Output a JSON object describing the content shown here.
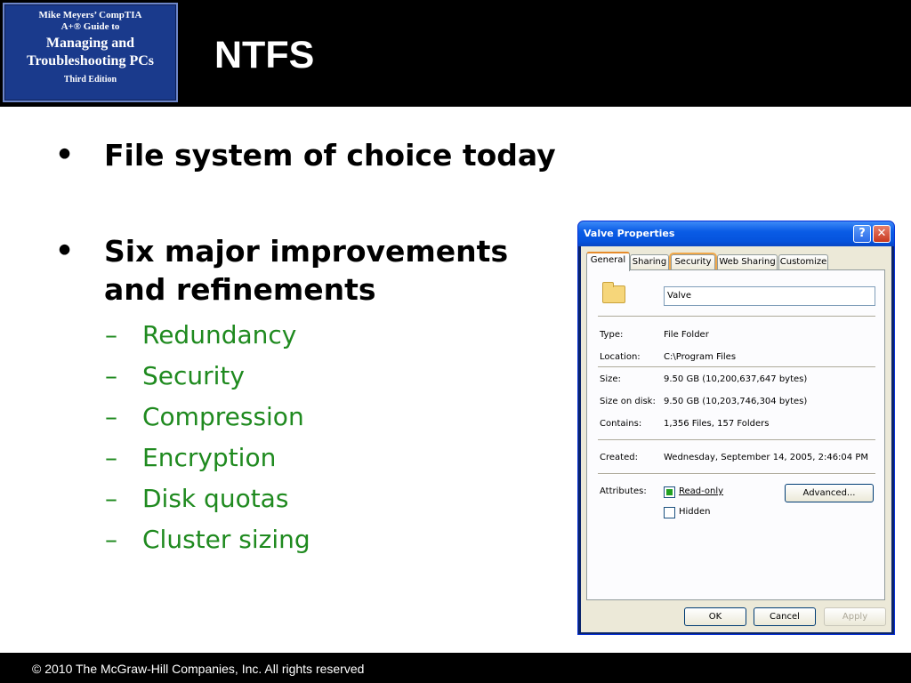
{
  "header": {
    "book": {
      "line1": "Mike Meyers’ CompTIA",
      "line2": "A+® Guide to",
      "line3": "Managing and",
      "line4": "Troubleshooting PCs",
      "line5": "Third Edition"
    },
    "title": "NTFS"
  },
  "bullets": [
    {
      "text": "File system of choice today"
    },
    {
      "text_line1": "Six major improvements",
      "text_line2": "and refinements"
    }
  ],
  "sub_bullets": [
    "Redundancy",
    "Security",
    "Compression",
    "Encryption",
    "Disk quotas",
    "Cluster sizing"
  ],
  "dialog": {
    "title": "Valve Properties",
    "help_glyph": "?",
    "close_glyph": "✕",
    "tabs": [
      "General",
      "Sharing",
      "Security",
      "Web Sharing",
      "Customize"
    ],
    "name_value": "Valve",
    "properties": [
      {
        "label": "Type:",
        "value": "File Folder"
      },
      {
        "label": "Location:",
        "value": "C:\\Program Files"
      },
      {
        "label": "Size:",
        "value": "9.50 GB (10,200,637,647 bytes)"
      },
      {
        "label": "Size on disk:",
        "value": "9.50 GB (10,203,746,304 bytes)"
      },
      {
        "label": "Contains:",
        "value": "1,356 Files, 157 Folders"
      }
    ],
    "created": {
      "label": "Created:",
      "value": "Wednesday, September 14, 2005, 2:46:04 PM"
    },
    "attributes": {
      "label": "Attributes:",
      "read_only": "Read-only",
      "hidden": "Hidden",
      "advanced_button": "Advanced..."
    },
    "buttons": {
      "ok": "OK",
      "cancel": "Cancel",
      "apply": "Apply"
    }
  },
  "footer": {
    "text": "© 2010 The McGraw-Hill Companies, Inc. All rights reserved"
  }
}
